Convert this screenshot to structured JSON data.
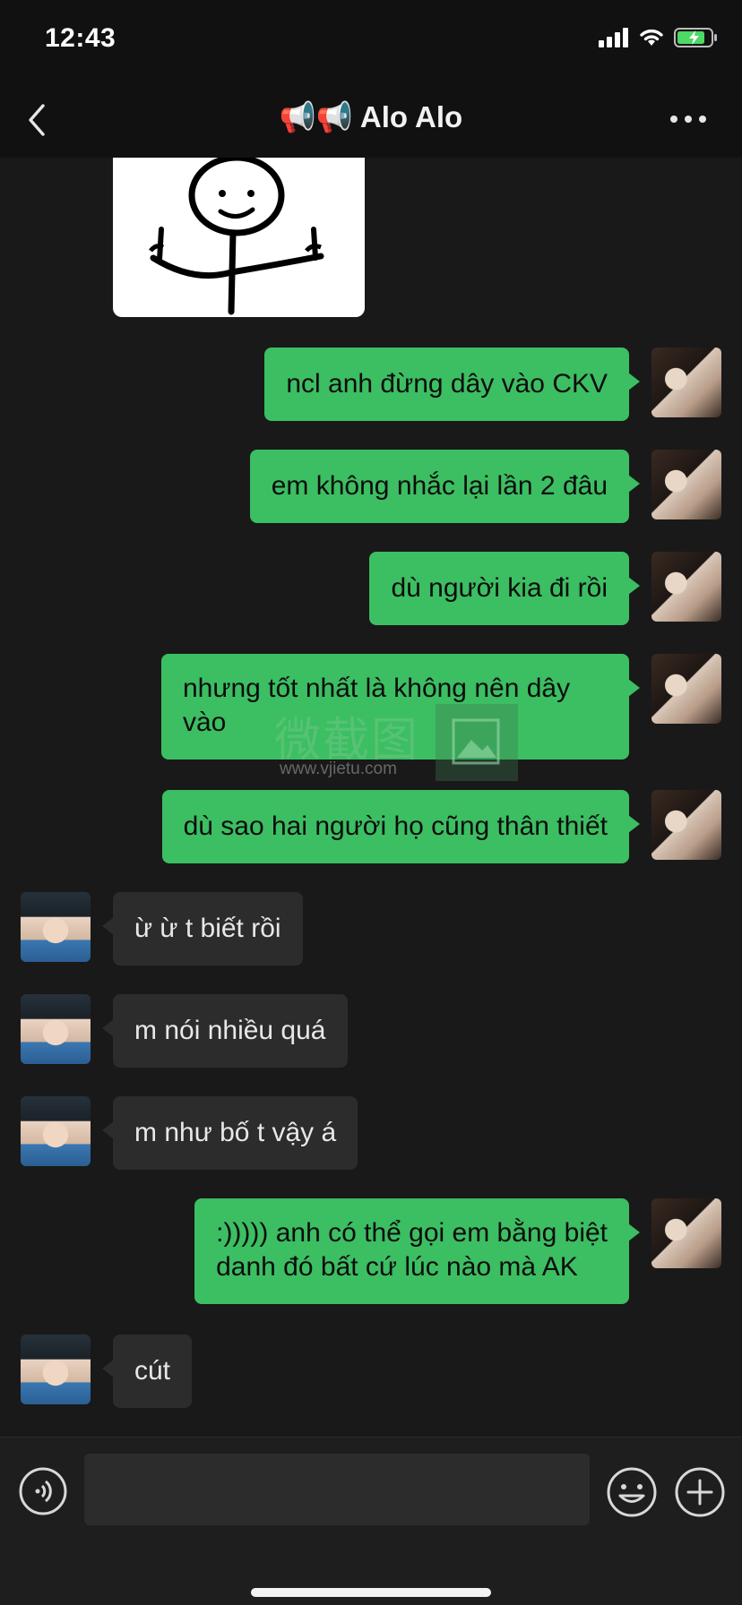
{
  "status_bar": {
    "time": "12:43"
  },
  "header": {
    "title": "📢📢 Alo Alo"
  },
  "watermark": {
    "text": "微截图",
    "url": "www.vjietu.com"
  },
  "messages": [
    {
      "from": "me",
      "lines": [
        "ncl anh đừng dây vào CKV"
      ]
    },
    {
      "from": "me",
      "lines": [
        "em không nhắc lại lần 2 đâu"
      ]
    },
    {
      "from": "me",
      "lines": [
        "dù người kia đi rồi"
      ]
    },
    {
      "from": "me",
      "lines": [
        "nhưng tốt nhất là không nên dây",
        "vào"
      ]
    },
    {
      "from": "me",
      "lines": [
        "dù sao hai người họ cũng thân thiết"
      ]
    },
    {
      "from": "them",
      "lines": [
        "ừ ừ t biết rồi"
      ]
    },
    {
      "from": "them",
      "lines": [
        "m nói nhiều quá"
      ]
    },
    {
      "from": "them",
      "lines": [
        "m như bố t vậy á"
      ]
    },
    {
      "from": "me",
      "lines": [
        ":))))) anh có thể gọi em bằng biệt",
        "danh đó bất cứ lúc nào mà AK"
      ]
    },
    {
      "from": "them",
      "lines": [
        "cút"
      ]
    }
  ],
  "input": {
    "value": "",
    "placeholder": ""
  },
  "icons": {
    "back": "chevron-left-icon",
    "more": "more-dots-icon",
    "voice": "voice-icon",
    "emoji": "emoji-icon",
    "plus": "plus-icon"
  },
  "colors": {
    "my_bubble": "#3cbe62",
    "their_bubble": "#2c2c2c",
    "background": "#191919"
  }
}
